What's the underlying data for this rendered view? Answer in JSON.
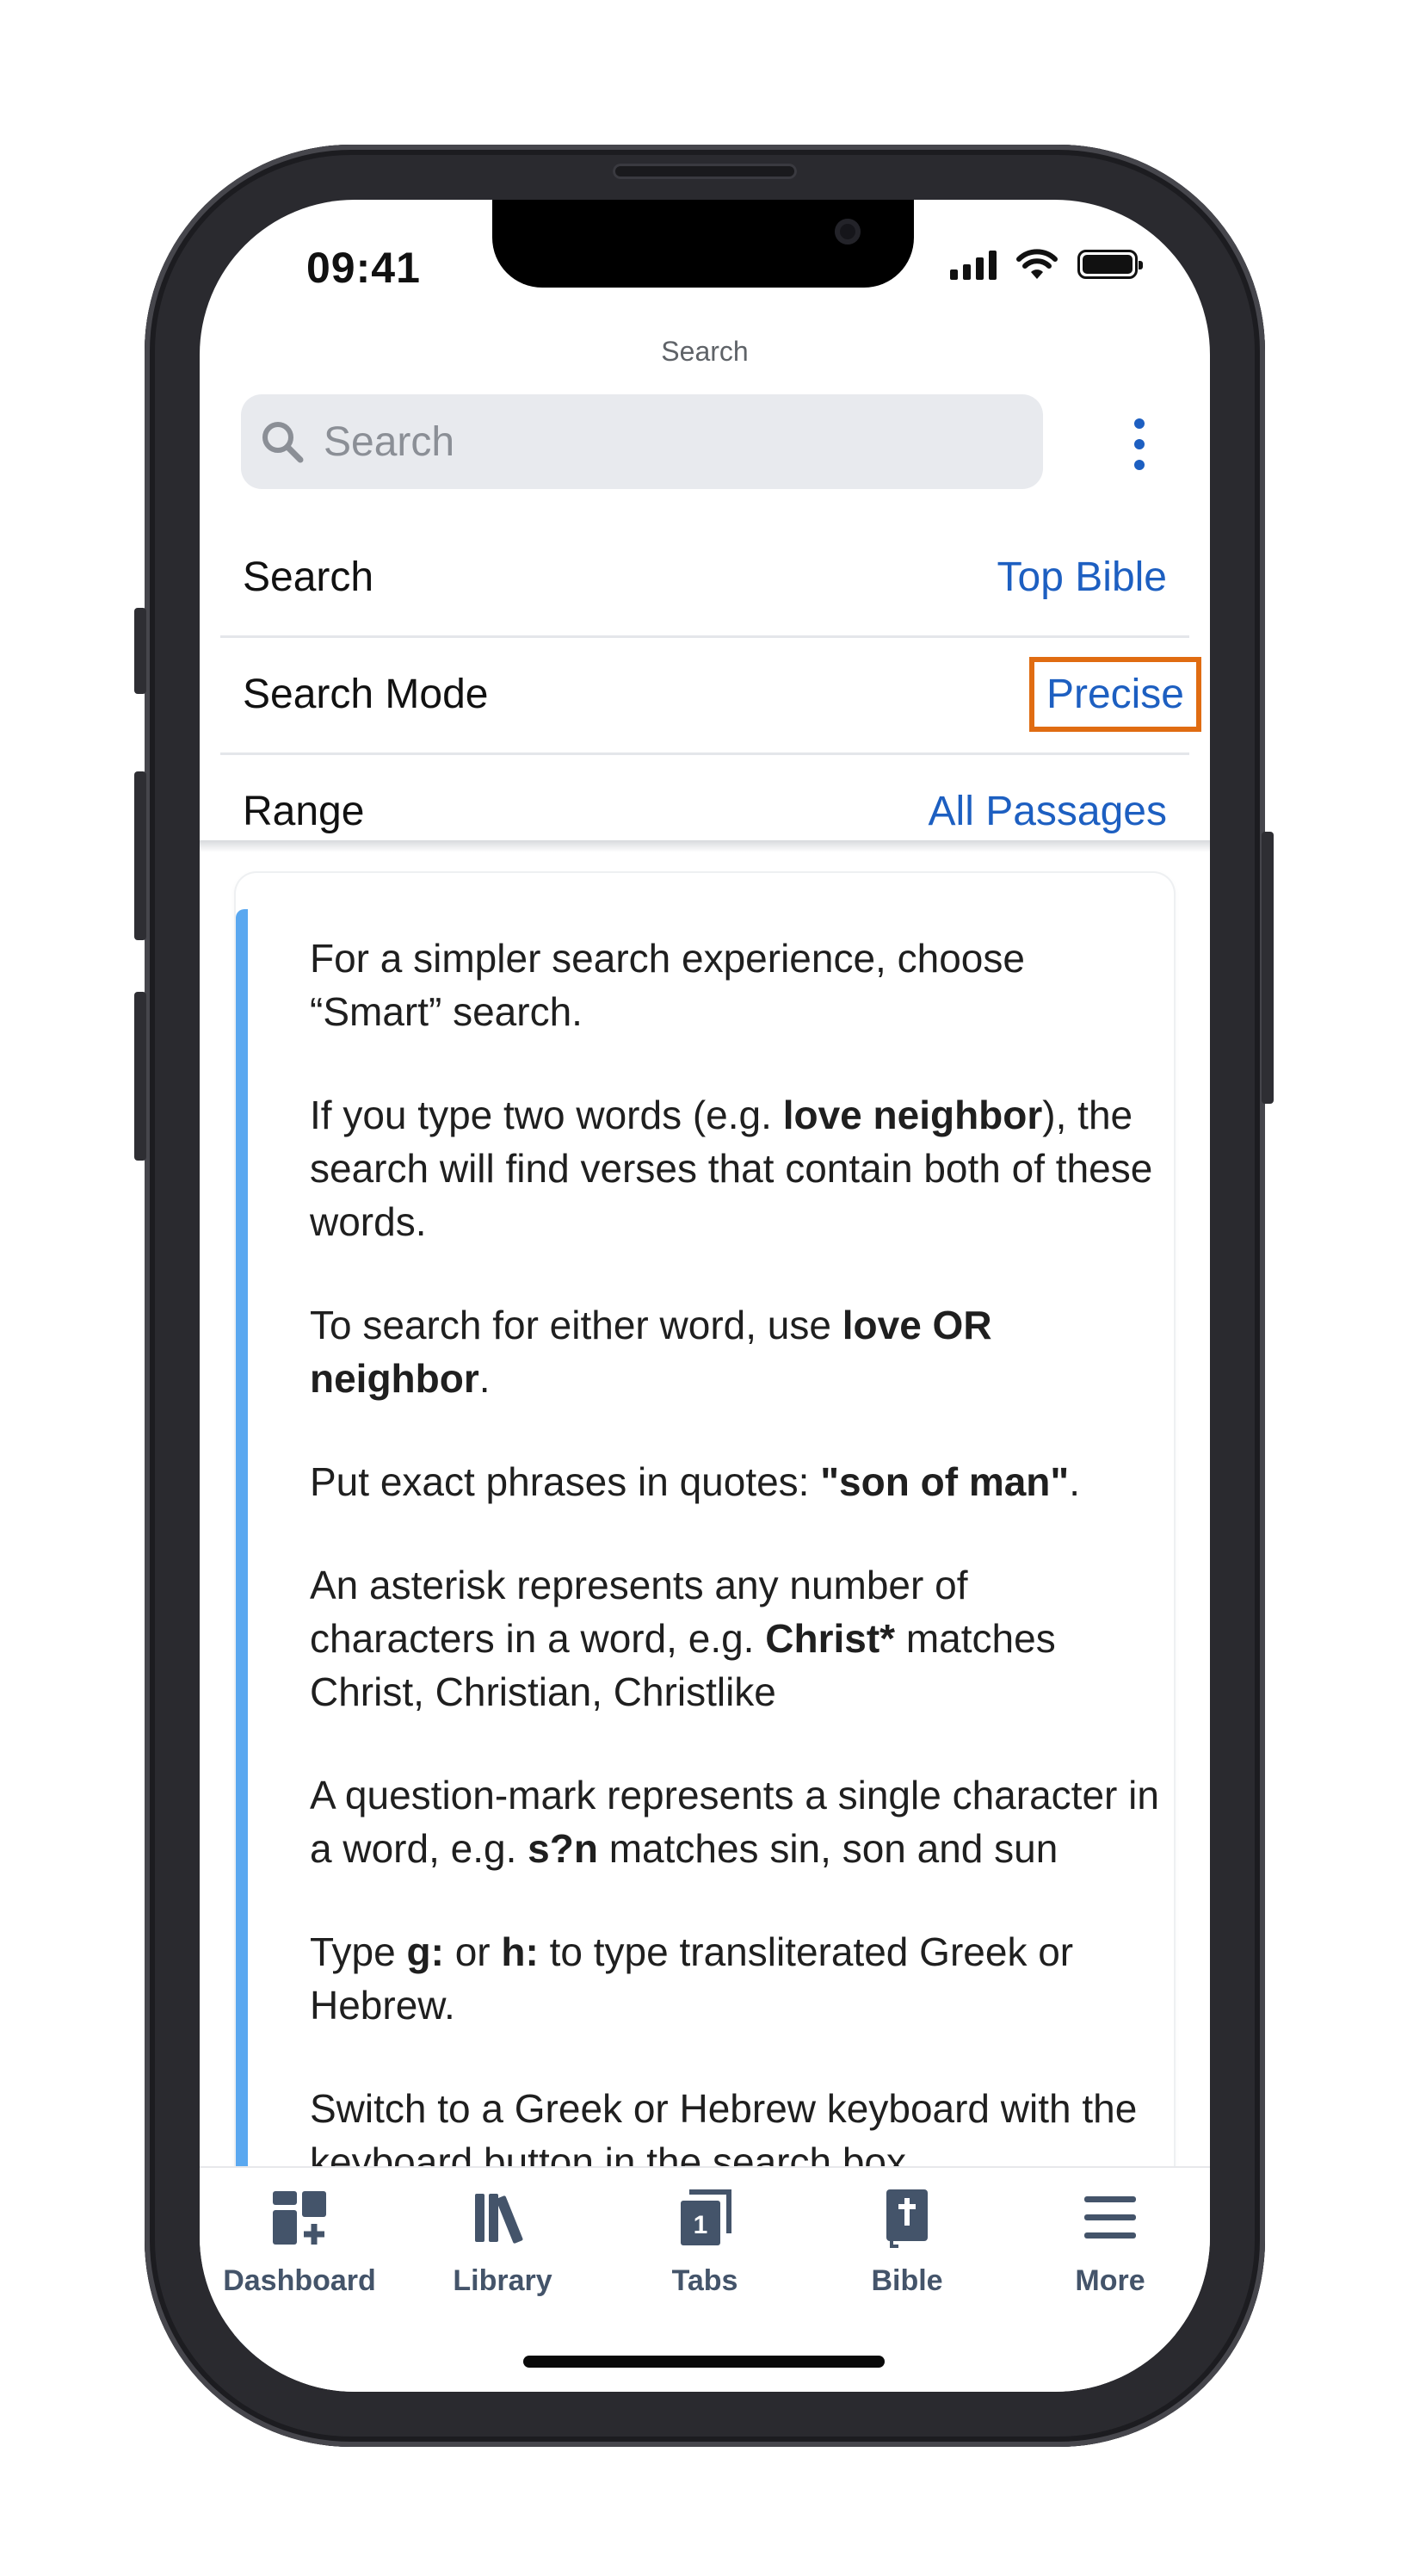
{
  "status_bar": {
    "time": "09:41"
  },
  "nav": {
    "title": "Search"
  },
  "search": {
    "placeholder": "Search"
  },
  "settings": [
    {
      "label": "Search",
      "value": "Top Bible"
    },
    {
      "label": "Search Mode",
      "value": "Precise"
    },
    {
      "label": "Range",
      "value": "All Passages"
    }
  ],
  "help": {
    "p1": "For a simpler search experience, choose “Smart” search.",
    "p2_a": "If you type two words (e.g. ",
    "p2_b": "love neighbor",
    "p2_c": "), the search will find verses that contain both of these words.",
    "p3_a": "To search for either word, use ",
    "p3_b": "love OR neighbor",
    "p3_c": ".",
    "p4_a": "Put exact phrases in quotes: ",
    "p4_b": "\"son of man\"",
    "p4_c": ".",
    "p5_a": "An asterisk represents any number of characters in a word, e.g. ",
    "p5_b": "Christ*",
    "p5_c": " matches Christ, Christian, Christlike",
    "p6_a": "A question-mark represents a single character in a word, e.g. ",
    "p6_b": "s?n",
    "p6_c": " matches sin, son and sun",
    "p7_a": "Type ",
    "p7_b": "g:",
    "p7_c": " or ",
    "p7_d": "h:",
    "p7_e": " to type transliterated Greek or Hebrew.",
    "p8": "Switch to a Greek or Hebrew keyboard with the keyboard button in the search box."
  },
  "tabs": [
    {
      "label": "Dashboard",
      "icon": "dashboard-icon"
    },
    {
      "label": "Library",
      "icon": "library-icon"
    },
    {
      "label": "Tabs",
      "icon": "tabs-icon",
      "badge": "1"
    },
    {
      "label": "Bible",
      "icon": "bible-icon"
    },
    {
      "label": "More",
      "icon": "menu-icon"
    }
  ],
  "colors": {
    "accent": "#1d5fc1",
    "highlight": "#e06c12",
    "card_accent": "#5aa8f0"
  }
}
